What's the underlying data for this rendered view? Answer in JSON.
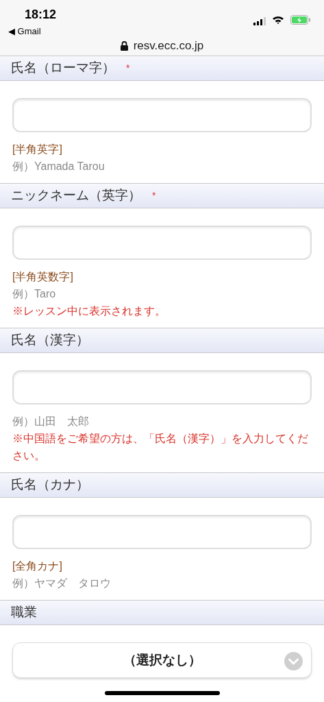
{
  "status_bar": {
    "time": "18:12",
    "back_label": "◀ Gmail"
  },
  "address_bar": {
    "url": "resv.ecc.co.jp"
  },
  "sections": [
    {
      "label": "氏名（ローマ字）",
      "required_mark": "*",
      "kind": "text",
      "notes": [
        {
          "kind": "format",
          "text": "[半角英字]"
        },
        {
          "kind": "example",
          "text": "例）Yamada Tarou"
        }
      ]
    },
    {
      "label": "ニックネーム（英字）",
      "required_mark": "*",
      "kind": "text",
      "notes": [
        {
          "kind": "format",
          "text": "[半角英数字]"
        },
        {
          "kind": "example",
          "text": "例）Taro"
        },
        {
          "kind": "warning",
          "text": "※レッスン中に表示されます。"
        }
      ]
    },
    {
      "label": "氏名（漢字）",
      "kind": "text",
      "notes": [
        {
          "kind": "example",
          "text": "例）山田　太郎"
        },
        {
          "kind": "warning",
          "text": "※中国語をご希望の方は、「氏名（漢字）」を入力してください。"
        }
      ]
    },
    {
      "label": "氏名（カナ）",
      "kind": "text",
      "notes": [
        {
          "kind": "format",
          "text": "[全角カナ]"
        },
        {
          "kind": "example",
          "text": "例）ヤマダ　タロウ"
        }
      ]
    },
    {
      "label": "職業",
      "kind": "select",
      "value": "（選択なし）"
    }
  ]
}
